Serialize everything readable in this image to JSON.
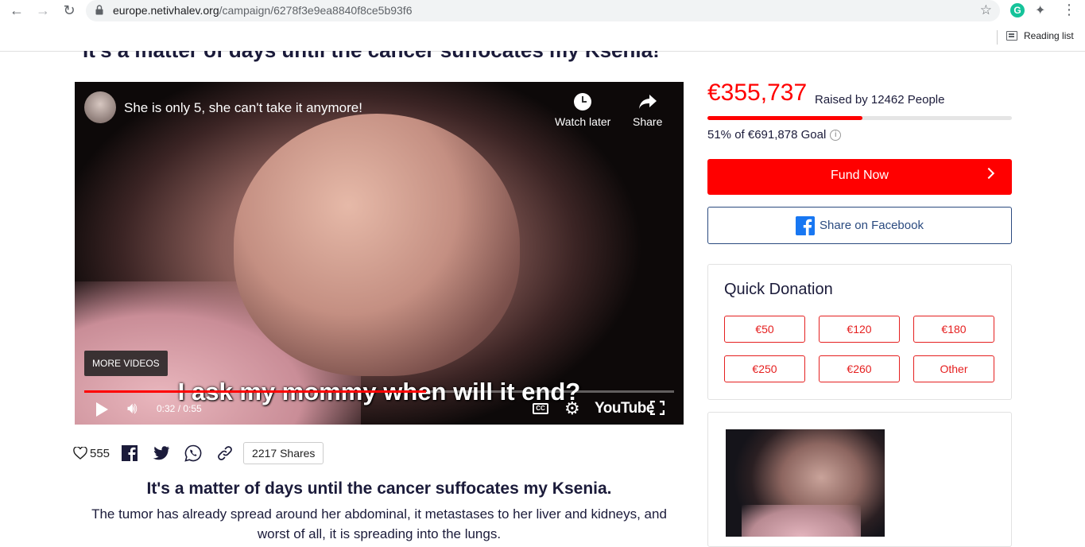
{
  "browser": {
    "url_host": "europe.netivhalev.org",
    "url_path": "/campaign/6278f3e9ea8840f8ce5b93f6",
    "reading_list": "Reading list",
    "grammarly_letter": "G"
  },
  "page": {
    "top_title": "It's a matter of days until the cancer suffocates my Ksenia!"
  },
  "video": {
    "title": "She is only 5, she can't take it anymore!",
    "watch_later": "Watch later",
    "share": "Share",
    "more_videos": "MORE VIDEOS",
    "subtitle": "I ask my mommy when will it end?",
    "time": "0:32 / 0:55",
    "progress": 0.58,
    "cc": "CC",
    "logo": "YouTube"
  },
  "social": {
    "likes": "555",
    "shares": "2217 Shares"
  },
  "story": {
    "title": "It's a matter of days until the cancer suffocates my Ksenia.",
    "text": "The tumor has already spread around her abdominal, it metastases to her liver and kidneys, and worst of all, it is spreading into the lungs."
  },
  "campaign": {
    "amount": "€355,737",
    "raised": "Raised by 12462 People",
    "goal_text": "51% of €691,878 Goal",
    "goal_fraction": 0.51,
    "info": "i",
    "fund_now": "Fund Now",
    "share_facebook": "Share on Facebook",
    "accent_color": "#ff0000"
  },
  "quick_donation": {
    "title": "Quick Donation",
    "options": [
      "€50",
      "€120",
      "€180",
      "€250",
      "€260",
      "Other"
    ]
  }
}
